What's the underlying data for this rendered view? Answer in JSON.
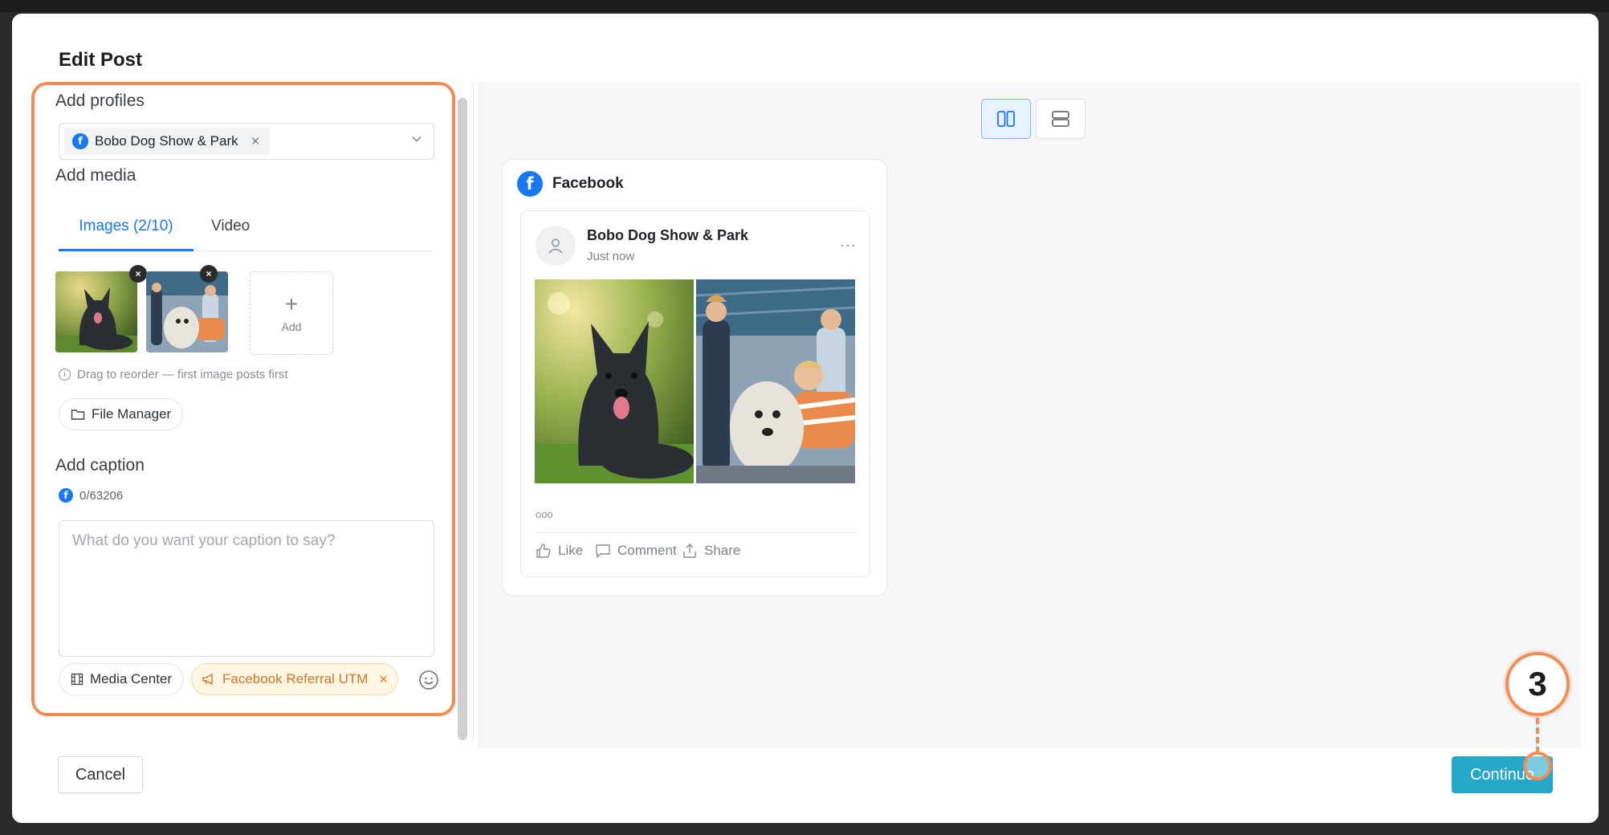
{
  "modal": {
    "title": "Edit Post"
  },
  "profiles": {
    "label": "Add profiles",
    "selected": [
      {
        "name": "Bobo Dog Show & Park",
        "network": "facebook"
      }
    ],
    "remove_icon": "close-icon",
    "dropdown_icon": "chevron-down-icon"
  },
  "media": {
    "label": "Add media",
    "tabs": [
      {
        "label": "Images (2/10)",
        "active": true
      },
      {
        "label": "Video",
        "active": false
      }
    ],
    "images": [
      {
        "subject": "dog"
      },
      {
        "subject": "people-with-dog"
      }
    ],
    "add_label": "Add",
    "add_symbol": "+",
    "remove_symbol": "×",
    "hint": "Drag to reorder — first image posts first",
    "file_manager_label": "File Manager"
  },
  "caption": {
    "label": "Add caption",
    "count": "0/63206",
    "value": "",
    "placeholder": "What do you want your caption to say?",
    "media_center_label": "Media Center",
    "utm_label": "Facebook Referral UTM",
    "utm_remove": "×"
  },
  "preview": {
    "network_name": "Facebook",
    "post_author": "Bobo Dog Show & Park",
    "post_time": "Just now",
    "more_symbol": "···",
    "reactions": "ooo",
    "actions": [
      {
        "label": "Like",
        "icon": "thumbs-up-icon"
      },
      {
        "label": "Comment",
        "icon": "comment-icon"
      },
      {
        "label": "Share",
        "icon": "share-icon"
      }
    ],
    "view_modes": [
      {
        "icon": "columns-icon",
        "active": true
      },
      {
        "icon": "rows-icon",
        "active": false
      }
    ]
  },
  "footer": {
    "cancel_label": "Cancel",
    "continue_label": "Continue"
  },
  "annotation": {
    "step": "3"
  },
  "colors": {
    "accent": "#1677ff",
    "facebook": "#1877f2",
    "continue": "#25a8c8",
    "annotation": "#f28c52",
    "utm": "#d0772c"
  }
}
